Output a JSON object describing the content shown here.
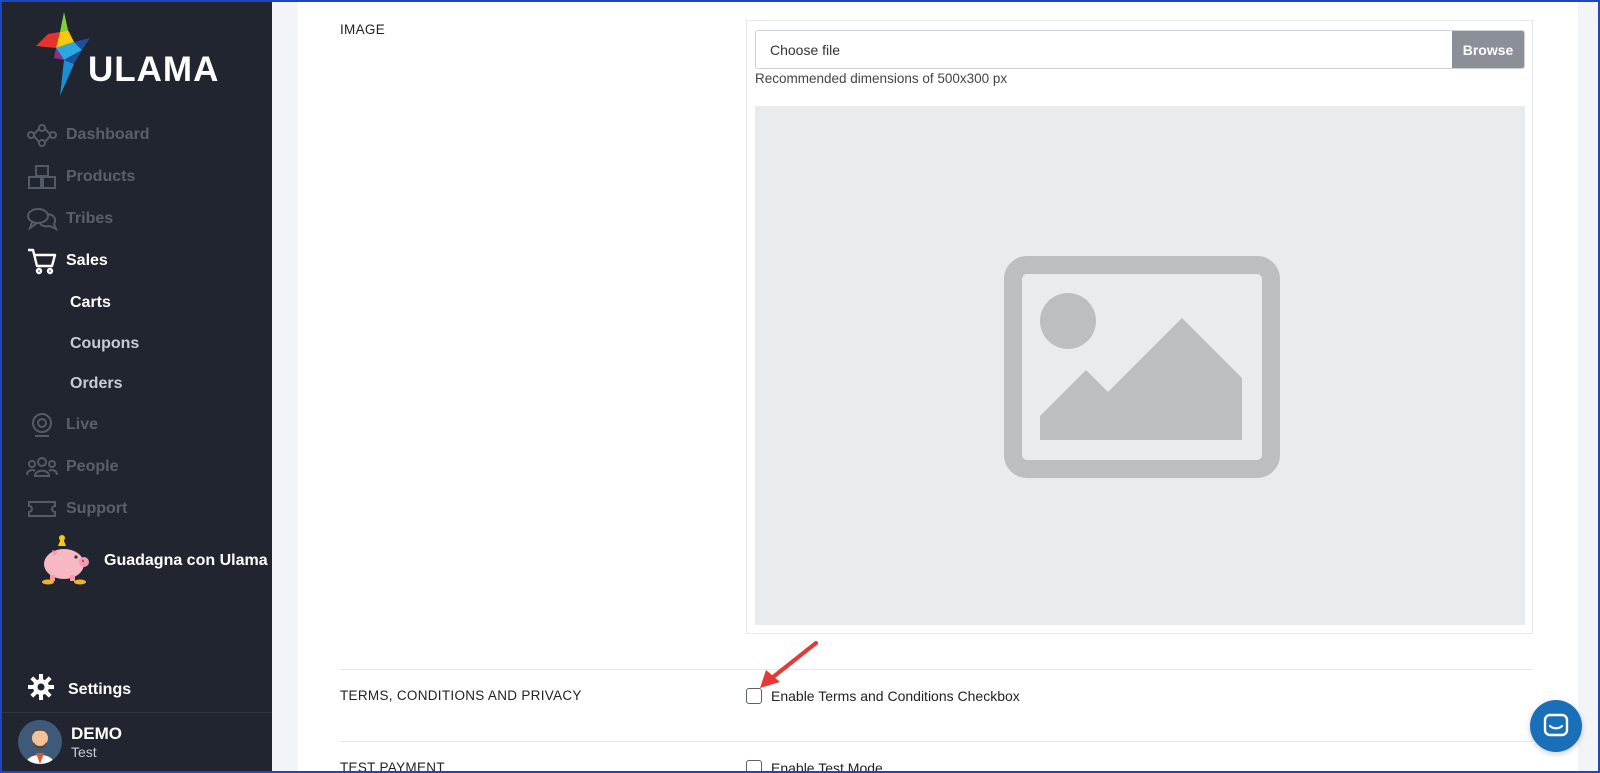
{
  "brand": {
    "name": "ULAMA"
  },
  "sidebar": {
    "items": [
      {
        "label": "Dashboard",
        "icon": "network-icon"
      },
      {
        "label": "Products",
        "icon": "boxes-icon"
      },
      {
        "label": "Tribes",
        "icon": "chat-bubbles-icon"
      },
      {
        "label": "Sales",
        "icon": "cart-icon"
      },
      {
        "label": "Live",
        "icon": "webcam-icon"
      },
      {
        "label": "People",
        "icon": "people-icon"
      },
      {
        "label": "Support",
        "icon": "ticket-icon"
      }
    ],
    "sales_sub": [
      {
        "label": "Carts"
      },
      {
        "label": "Coupons"
      },
      {
        "label": "Orders"
      }
    ],
    "earn": {
      "label": "Guadagna con Ulama",
      "icon": "piggy-bank-icon"
    },
    "settings": {
      "label": "Settings",
      "icon": "gear-icon"
    },
    "user": {
      "name": "DEMO",
      "subtitle": "Test"
    }
  },
  "form": {
    "image": {
      "label": "IMAGE",
      "file_placeholder": "Choose file",
      "browse_label": "Browse",
      "hint": "Recommended dimensions of 500x300 px"
    },
    "terms": {
      "label": "TERMS, CONDITIONS AND PRIVACY",
      "checkbox_label": "Enable Terms and Conditions Checkbox",
      "checked": false
    },
    "test_payment": {
      "label": "TEST PAYMENT",
      "checkbox_label": "Enable Test Mode",
      "checked": false
    }
  },
  "colors": {
    "sidebar_bg": "#21252f",
    "accent": "#1a70b8",
    "annotation_arrow": "#e53935"
  }
}
